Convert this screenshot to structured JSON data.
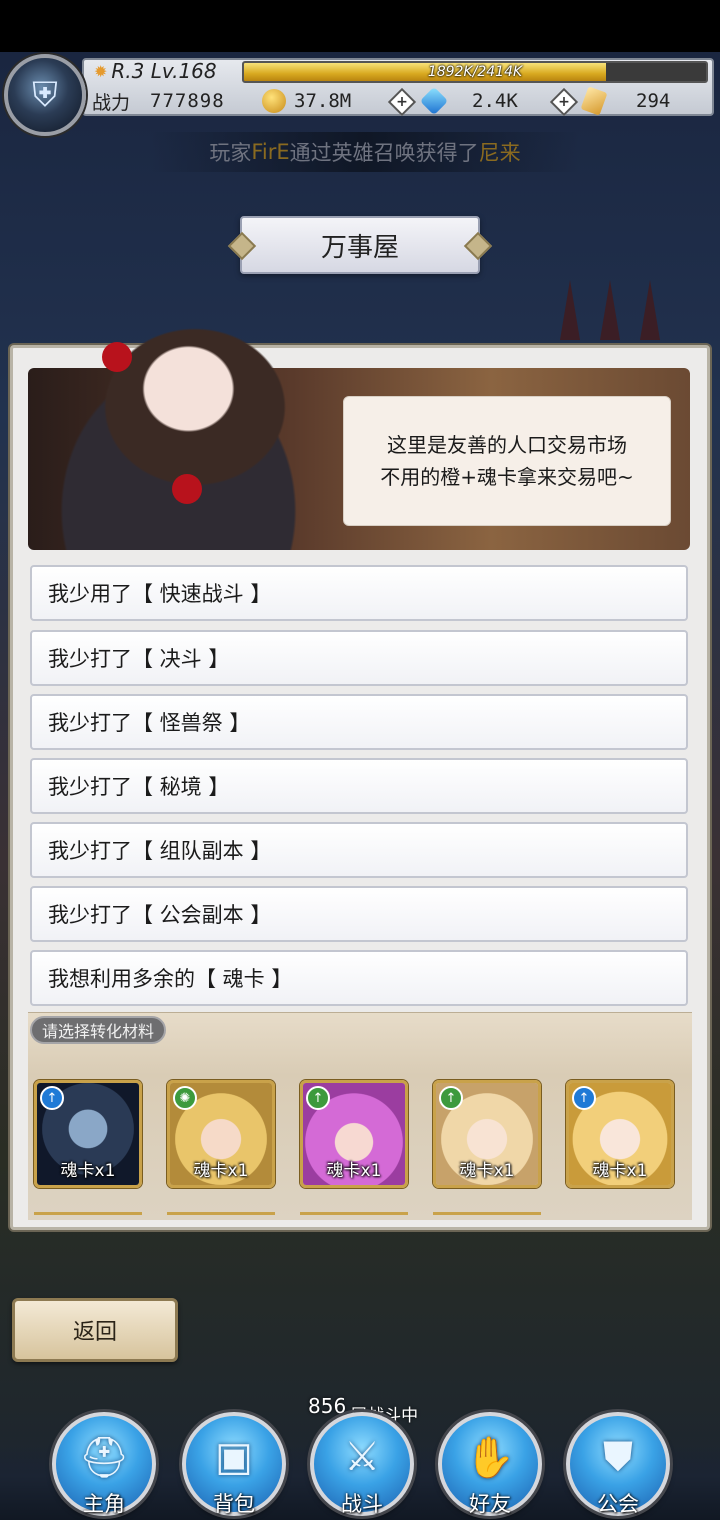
{
  "player": {
    "rank": "R.3 Lv.168",
    "exp_text": "1892K/2414K",
    "exp_fraction": 0.784,
    "power_label": "战力",
    "power_value": "777898"
  },
  "currencies": {
    "gold": "37.8M",
    "diamond": "2.4K",
    "scroll": "294"
  },
  "ticker": {
    "prefix": "玩家",
    "player_name": "FirE",
    "middle": "通过英雄召唤获得了",
    "hero": "尼来"
  },
  "title": "万事屋",
  "speech": {
    "line1": "这里是友善的人口交易市场",
    "line2": "不用的橙+魂卡拿来交易吧~"
  },
  "options": [
    "我少用了【 快速战斗 】",
    "我少打了【 决斗 】",
    "我少打了【 怪兽祭 】",
    "我少打了【 秘境 】",
    "我少打了【 组队副本 】",
    "我少打了【 公会副本 】",
    "我想利用多余的【 魂卡 】"
  ],
  "materials": {
    "label": "请选择转化材料",
    "cards": [
      {
        "count": "魂卡x1",
        "element_icon": "sword-icon"
      },
      {
        "count": "魂卡x1",
        "element_icon": "swirl-icon"
      },
      {
        "count": "魂卡x1",
        "element_icon": "sword-icon"
      },
      {
        "count": "魂卡x1",
        "element_icon": "sword-icon"
      },
      {
        "count": "魂卡x1",
        "element_icon": "sword-icon"
      }
    ]
  },
  "back_label": "返回",
  "floor": {
    "number": "856",
    "text": "层战斗中"
  },
  "nav": [
    {
      "label": "主角",
      "icon": "helmet-icon"
    },
    {
      "label": "背包",
      "icon": "backpack-icon"
    },
    {
      "label": "战斗",
      "icon": "crossed-swords-icon"
    },
    {
      "label": "好友",
      "icon": "handshake-icon"
    },
    {
      "label": "公会",
      "icon": "guild-crest-icon"
    }
  ],
  "colors": {
    "gold": "#d8a91f",
    "accent_blue": "#3aa2e6",
    "card_border": "#c9a24a"
  }
}
